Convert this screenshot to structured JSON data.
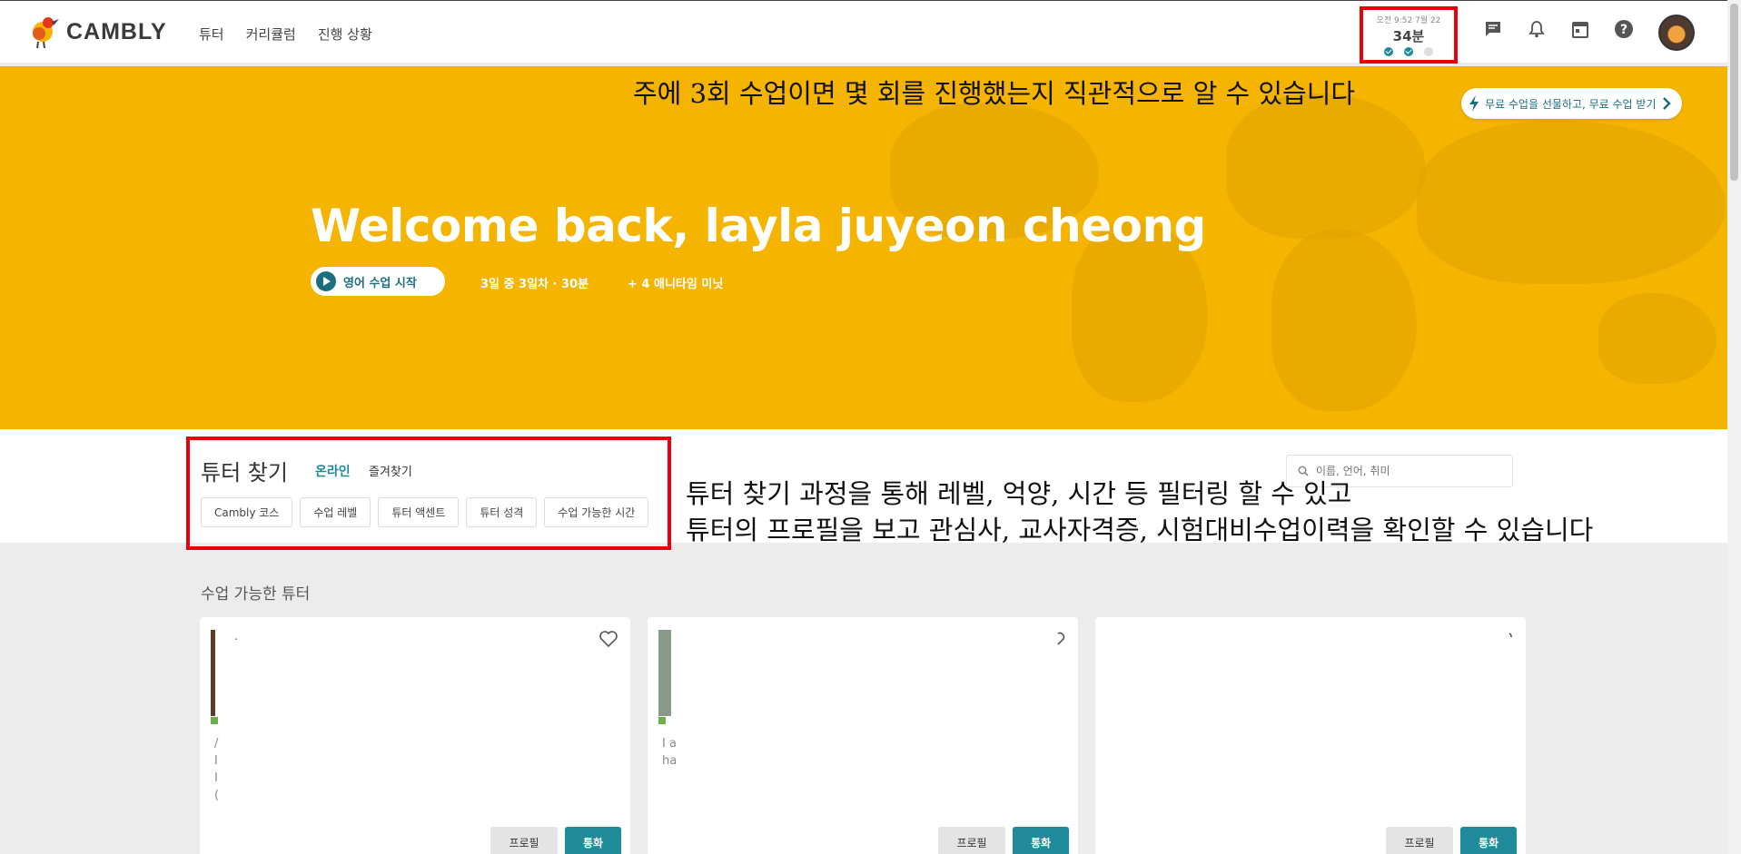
{
  "header": {
    "logo_text": "CAMBLY",
    "nav": [
      "튜터",
      "커리큘럼",
      "진행 상황"
    ],
    "progress_widget": {
      "time_label": "오전 9:52 7월 22",
      "minutes": "34분",
      "lessons_completed": 2,
      "lessons_goal": 3
    },
    "icons": [
      "chat-icon",
      "bell-icon",
      "calendar-icon",
      "help-icon"
    ]
  },
  "hero": {
    "annotation": "주에 3회 수업이면 몇 회를 진행했는지 직관적으로 알 수 있습니다",
    "referral_label": "무료 수업을 선물하고, 무료 수업 받기",
    "welcome": "Welcome back, layla juyeon cheong",
    "start_label": "영어 수업 시작",
    "streak": "3일 중 3일차 · 30분",
    "anytime": "+ 4 애니타임 미닛"
  },
  "tutor_search": {
    "title": "튜터 찾기",
    "tab_online": "온라인",
    "tab_favorites": "즐겨찾기",
    "filters": [
      "Cambly 코스",
      "수업 레벨",
      "튜터 액센트",
      "튜터 성격",
      "수업 가능한 시간"
    ],
    "search_placeholder": "이름, 언어, 취미",
    "annotation_line1": "튜터 찾기 과정을 통해 레벨, 억양, 시간 등 필터링 할 수 있고",
    "annotation_line2": "튜터의 프로필을 보고 관심사, 교사자격증, 시험대비수업이력을 확인할 수 있습니다"
  },
  "available": {
    "title": "수업 가능한 튜터",
    "cards": [
      {
        "name": ".",
        "bio": [
          "/",
          "I",
          "I",
          "("
        ],
        "profile_label": "프로필",
        "call_label": "통화"
      },
      {
        "name": "",
        "bio": [
          "I a",
          "ha"
        ],
        "profile_label": "프로필",
        "call_label": "통화"
      },
      {
        "name": "",
        "bio": [],
        "profile_label": "프로필",
        "call_label": "통화"
      }
    ]
  },
  "colors": {
    "accent": "#1e8a9a",
    "hero": "#f4b400",
    "highlight": "#e8000b"
  }
}
